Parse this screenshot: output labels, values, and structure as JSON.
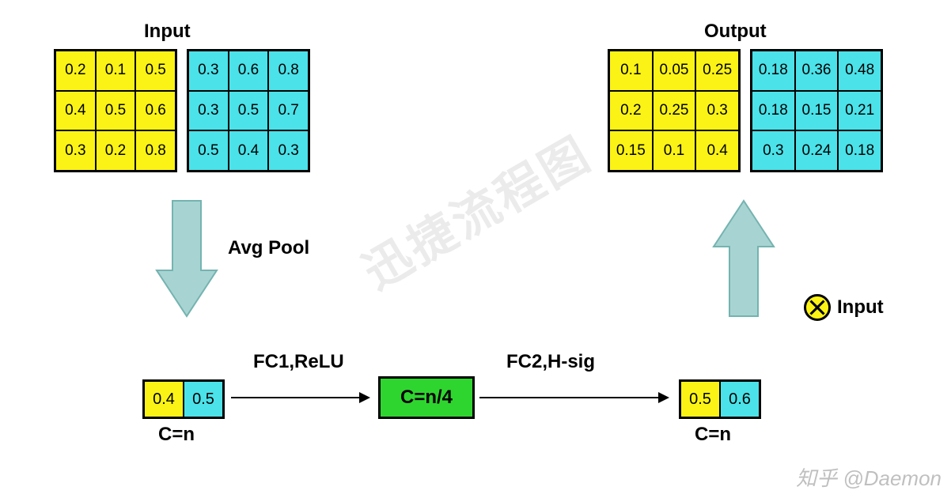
{
  "titles": {
    "input": "Input",
    "output": "Output"
  },
  "input_grids": {
    "yellow": [
      "0.2",
      "0.1",
      "0.5",
      "0.4",
      "0.5",
      "0.6",
      "0.3",
      "0.2",
      "0.8"
    ],
    "cyan": [
      "0.3",
      "0.6",
      "0.8",
      "0.3",
      "0.5",
      "0.7",
      "0.5",
      "0.4",
      "0.3"
    ]
  },
  "output_grids": {
    "yellow": [
      "0.1",
      "0.05",
      "0.25",
      "0.2",
      "0.25",
      "0.3",
      "0.15",
      "0.1",
      "0.4"
    ],
    "cyan": [
      "0.18",
      "0.36",
      "0.48",
      "0.18",
      "0.15",
      "0.21",
      "0.3",
      "0.24",
      "0.18"
    ]
  },
  "pooled": {
    "yellow": "0.4",
    "cyan": "0.5"
  },
  "scale": {
    "yellow": "0.5",
    "cyan": "0.6"
  },
  "labels": {
    "avgpool": "Avg Pool",
    "fc1": "FC1,ReLU",
    "fc2": "FC2,H-sig",
    "cn_left": "C=n",
    "cn_mid": "C=n/4",
    "cn_right": "C=n",
    "otimes_input": "Input"
  },
  "watermark": {
    "center": "迅捷流程图",
    "corner": "知乎 @Daemon"
  },
  "colors": {
    "yellow": "#fbf315",
    "cyan": "#4be2e9",
    "green": "#2fd52f",
    "arrow_fill": "#a7d4d2"
  },
  "chart_data": {
    "type": "table",
    "description": "SE-block style diagram: two input channel feature maps are globally avg-pooled to a C=n vector, passed through FC1+ReLU to C=n/4, then FC2+H-sigmoid back to C=n, which channel-wise multiplies the input to produce the output.",
    "input_channels": [
      [
        [
          0.2,
          0.1,
          0.5
        ],
        [
          0.4,
          0.5,
          0.6
        ],
        [
          0.3,
          0.2,
          0.8
        ]
      ],
      [
        [
          0.3,
          0.6,
          0.8
        ],
        [
          0.3,
          0.5,
          0.7
        ],
        [
          0.5,
          0.4,
          0.3
        ]
      ]
    ],
    "avg_pool": [
      0.4,
      0.5
    ],
    "bottleneck": "C=n/4",
    "scale_factors": [
      0.5,
      0.6
    ],
    "output_channels": [
      [
        [
          0.1,
          0.05,
          0.25
        ],
        [
          0.2,
          0.25,
          0.3
        ],
        [
          0.15,
          0.1,
          0.4
        ]
      ],
      [
        [
          0.18,
          0.36,
          0.48
        ],
        [
          0.18,
          0.15,
          0.21
        ],
        [
          0.3,
          0.24,
          0.18
        ]
      ]
    ],
    "ops": [
      "Avg Pool",
      "FC1,ReLU",
      "FC2,H-sig",
      "⊗ Input"
    ]
  }
}
